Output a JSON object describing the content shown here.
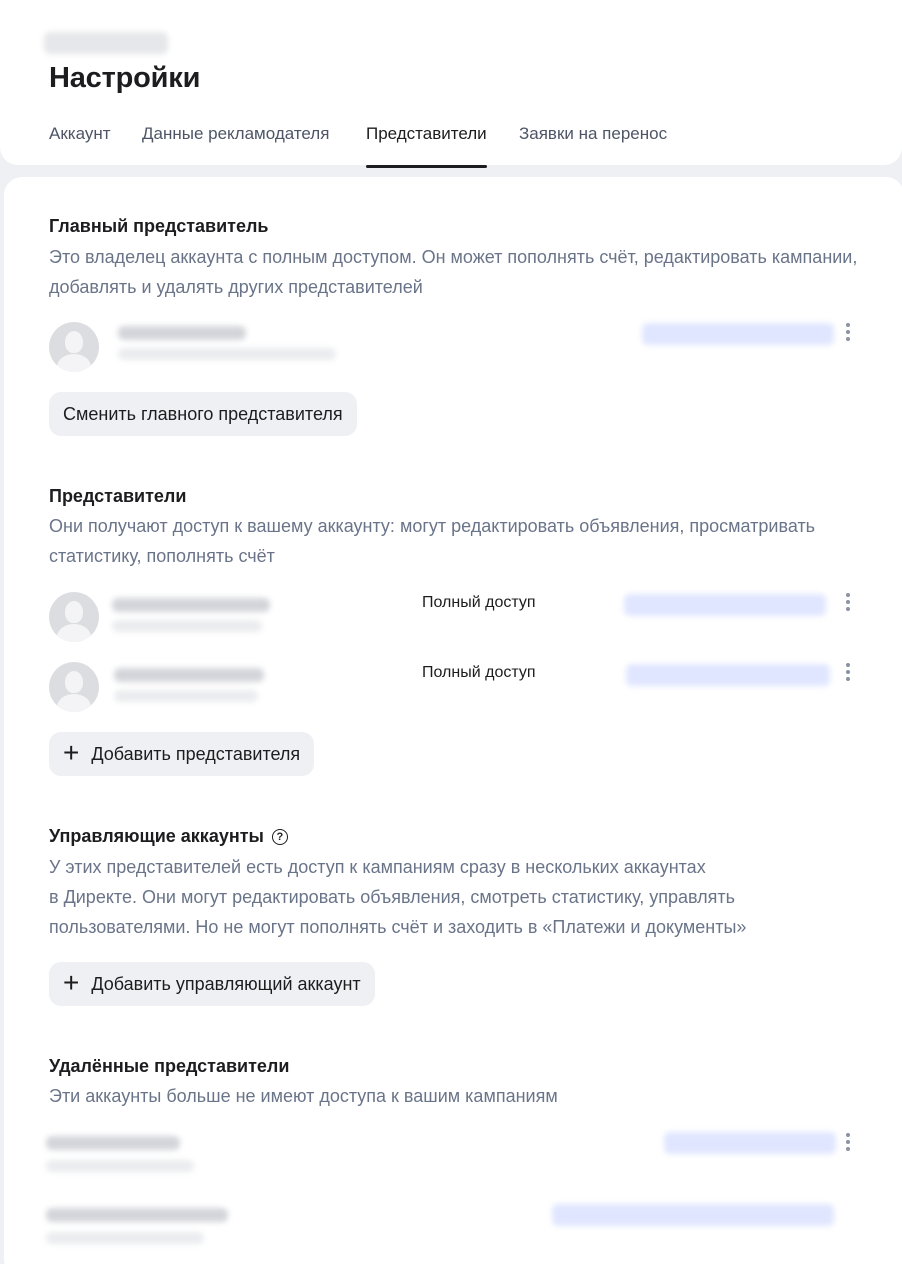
{
  "page": {
    "title": "Настройки"
  },
  "tabs": [
    {
      "label": "Аккаунт"
    },
    {
      "label": "Данные рекламодателя"
    },
    {
      "label": "Представители",
      "active": true
    },
    {
      "label": "Заявки на перенос"
    }
  ],
  "main_rep": {
    "title": "Главный представитель",
    "desc": "Это владелец аккаунта с полным доступом. Он может пополнять счёт, редактировать кампании, добавлять и удалять других представителей",
    "button": "Сменить главного представителя"
  },
  "reps": {
    "title": "Представители",
    "desc": "Они получают доступ к вашему аккаунту: могут редактировать объявления, просматривать статистику, пополнять счёт",
    "rows": [
      {
        "access": "Полный доступ"
      },
      {
        "access": "Полный доступ"
      }
    ],
    "add_button": "Добавить представителя"
  },
  "managers": {
    "title": "Управляющие аккаунты",
    "help_icon": "?",
    "desc_line1": "У этих представителей есть доступ к кампаниям сразу в нескольких аккаунтах",
    "desc_line2": "в Директе. Они могут редактировать объявления, смотреть статистику, управлять",
    "desc_line3": "пользователями. Но не могут пополнять счёт и заходить в «Платежи и документы»",
    "add_button": "Добавить управляющий аккаунт"
  },
  "deleted": {
    "title": "Удалённые представители",
    "desc": "Эти аккаунты больше не имеют доступа к вашим кампаниям"
  },
  "icons": {
    "plus": "+",
    "more": "more-vertical-icon",
    "avatar": "user-avatar-icon"
  },
  "colors": {
    "muted_text": "#6a7489",
    "button_bg": "#eef0f3",
    "page_bg": "#eef0f3"
  }
}
